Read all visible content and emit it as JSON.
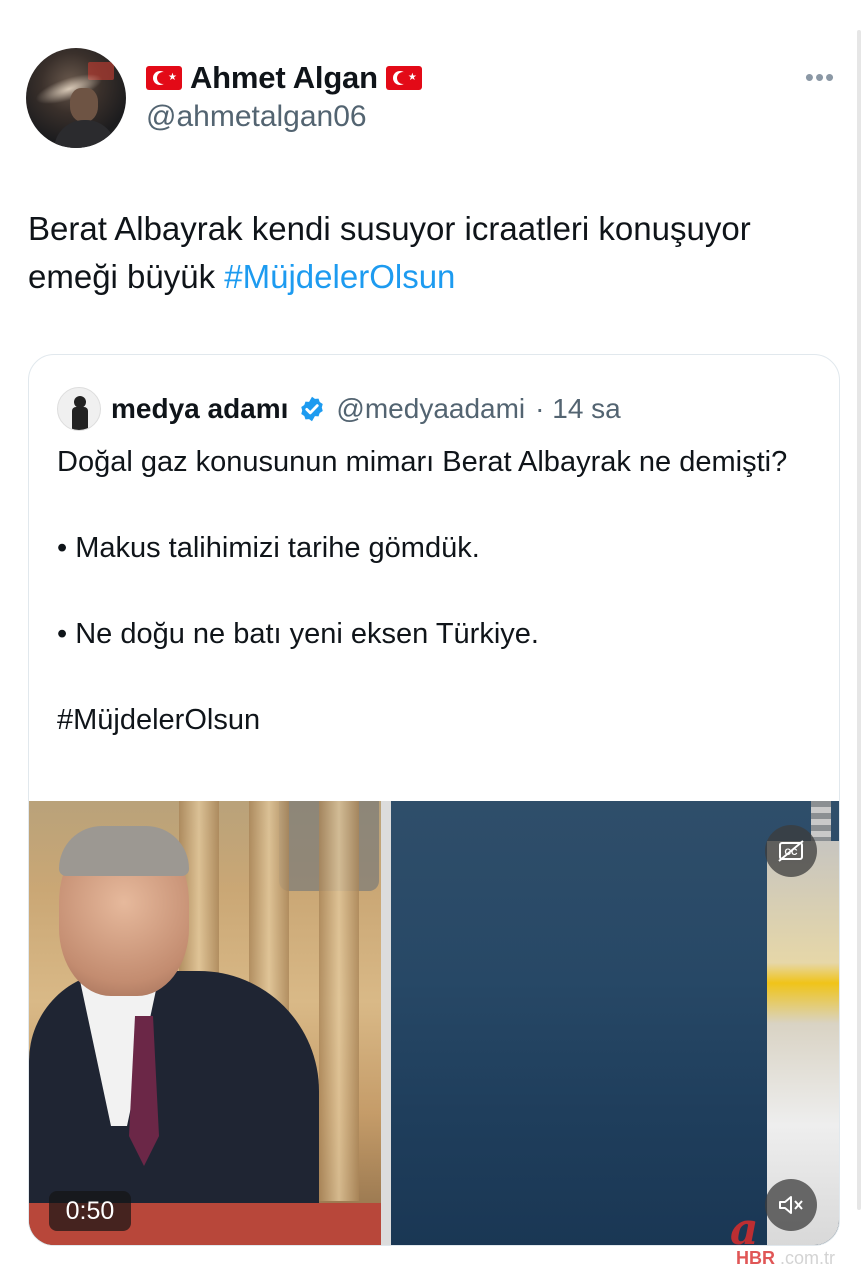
{
  "tweet": {
    "display_name": "Ahmet Algan",
    "handle": "@ahmetalgan06",
    "text_before_hashtag": "Berat Albayrak kendi susuyor icraatleri konuşuyor emeği büyük ",
    "hashtag": "#MüjdelerOlsun",
    "more_icon": "more-horizontal-icon"
  },
  "quoted_tweet": {
    "display_name": "medya adamı",
    "handle": "@medyaadami",
    "time": "· 14 sa",
    "verified_icon": "verified-badge-icon",
    "lines": [
      "Doğal gaz konusunun mimarı Berat Albayrak ne demişti?",
      "• Makus talihimizi tarihe gömdük.",
      "• Ne doğu ne batı yeni eksen Türkiye.",
      "#MüjdelerOlsun"
    ],
    "media": {
      "duration": "0:50",
      "captions_icon": "captions-icon",
      "mute_icon": "mute-icon"
    }
  },
  "watermark": {
    "logo_letter": "a",
    "brand": "HBR",
    "domain": ".com.tr"
  },
  "colors": {
    "link": "#1d9bf0",
    "secondary_text": "#536471",
    "primary_text": "#0f1419",
    "flag_red": "#e30a17",
    "verified_blue": "#1d9bf0"
  }
}
